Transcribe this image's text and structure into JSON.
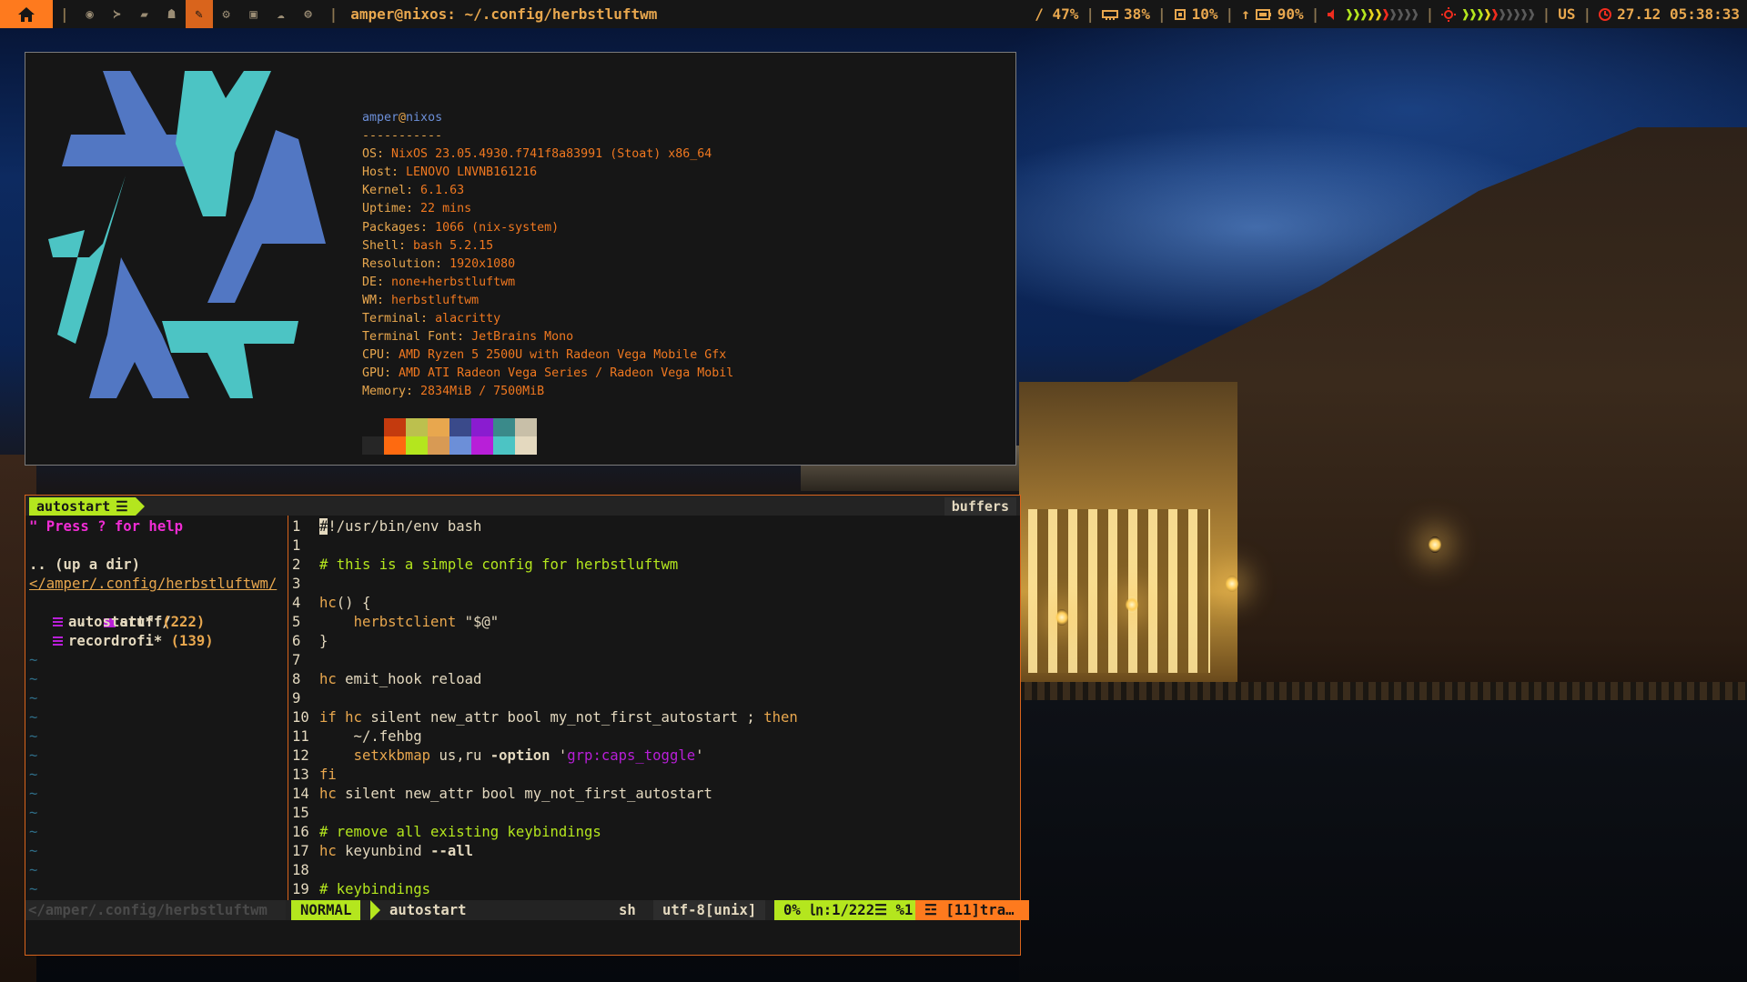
{
  "topbar": {
    "window_title": "amper@nixos: ~/.config/herbstluftwm",
    "disk": "/ 47%",
    "ram": "38%",
    "cpu": "10%",
    "battery": "90%",
    "keyboard_layout": "US",
    "datetime": "27.12 05:38:33",
    "volume_level": 0.55,
    "brightness_level": 0.5,
    "workspace_icons": [
      "chrome-icon",
      "terminal-icon",
      "folder-icon",
      "ghost-icon",
      "tools-icon",
      "gear-icon",
      "video-icon",
      "cloud-icon",
      "gamepad-icon"
    ],
    "active_workspace": 4
  },
  "neofetch": {
    "user": "amper",
    "host": "nixos",
    "separator": "-----------",
    "fields": [
      {
        "key": "OS",
        "value": "NixOS 23.05.4930.f741f8a83991 (Stoat) x86_64"
      },
      {
        "key": "Host",
        "value": "LENOVO LNVNB161216"
      },
      {
        "key": "Kernel",
        "value": "6.1.63"
      },
      {
        "key": "Uptime",
        "value": "22 mins"
      },
      {
        "key": "Packages",
        "value": "1066 (nix-system)"
      },
      {
        "key": "Shell",
        "value": "bash 5.2.15"
      },
      {
        "key": "Resolution",
        "value": "1920x1080"
      },
      {
        "key": "DE",
        "value": "none+herbstluftwm"
      },
      {
        "key": "WM",
        "value": "herbstluftwm"
      },
      {
        "key": "Terminal",
        "value": "alacritty"
      },
      {
        "key": "Terminal Font",
        "value": "JetBrains Mono"
      },
      {
        "key": "CPU",
        "value": "AMD Ryzen 5 2500U with Radeon Vega Mobile Gfx"
      },
      {
        "key": "GPU",
        "value": "AMD ATI Radeon Vega Series / Radeon Vega Mobil"
      },
      {
        "key": "Memory",
        "value": "2834MiB / 7500MiB"
      }
    ],
    "palette_top": [
      "#161616",
      "#c43a0e",
      "#bcc04e",
      "#e8a74e",
      "#3a4a8a",
      "#8a1cd0",
      "#3a8a8a",
      "#c8bfa8"
    ],
    "palette_bottom": [
      "#262626",
      "#fe6a10",
      "#b4e61e",
      "#d89a54",
      "#6c8fd8",
      "#b81fd8",
      "#4cc4c4",
      "#e4d9bf"
    ]
  },
  "vim": {
    "tab_label": "autostart",
    "buffers_label": "buffers",
    "tree": {
      "help": "\" Press ? for help",
      "updir": ".. (up a dir)",
      "path": "</amper/.config/herbstluftwm/",
      "folder": "stuff/",
      "files": [
        {
          "name": "autostart*",
          "count": "(222)"
        },
        {
          "name": "recordrofi*",
          "count": "(139)"
        }
      ],
      "tilde": "~"
    },
    "code": [
      {
        "n": "1",
        "t": "#!/usr/bin/env bash"
      },
      {
        "n": "1",
        "t": ""
      },
      {
        "n": "2",
        "t": "# this is a simple config for herbstluftwm"
      },
      {
        "n": "3",
        "t": ""
      },
      {
        "n": "4",
        "t": "hc() {"
      },
      {
        "n": "5",
        "t": "    herbstclient \"$@\""
      },
      {
        "n": "6",
        "t": "}"
      },
      {
        "n": "7",
        "t": ""
      },
      {
        "n": "8",
        "t": "hc emit_hook reload"
      },
      {
        "n": "9",
        "t": ""
      },
      {
        "n": "10",
        "t": "if hc silent new_attr bool my_not_first_autostart ; then"
      },
      {
        "n": "11",
        "t": "    ~/.fehbg"
      },
      {
        "n": "12",
        "t": "    setxkbmap us,ru -option 'grp:caps_toggle'"
      },
      {
        "n": "13",
        "t": "fi"
      },
      {
        "n": "14",
        "t": "hc silent new_attr bool my_not_first_autostart"
      },
      {
        "n": "15",
        "t": ""
      },
      {
        "n": "16",
        "t": "# remove all existing keybindings"
      },
      {
        "n": "17",
        "t": "hc keyunbind --all"
      },
      {
        "n": "18",
        "t": ""
      },
      {
        "n": "19",
        "t": "# keybindings"
      }
    ],
    "status": {
      "tree_path": "</amper/.config/herbstluftwm",
      "mode": "NORMAL",
      "file": "autostart",
      "filetype": "sh",
      "encoding": "utf-8[unix]",
      "position": "0% ㏑:1/222☰ %1",
      "warning": "☲ [11]tra…"
    }
  },
  "colors": {
    "accent_green": "#b4e61e",
    "accent_orange": "#fe7a1e",
    "accent_purple": "#b81fd8",
    "fg": "#e4d9bf",
    "bg": "#161616"
  }
}
